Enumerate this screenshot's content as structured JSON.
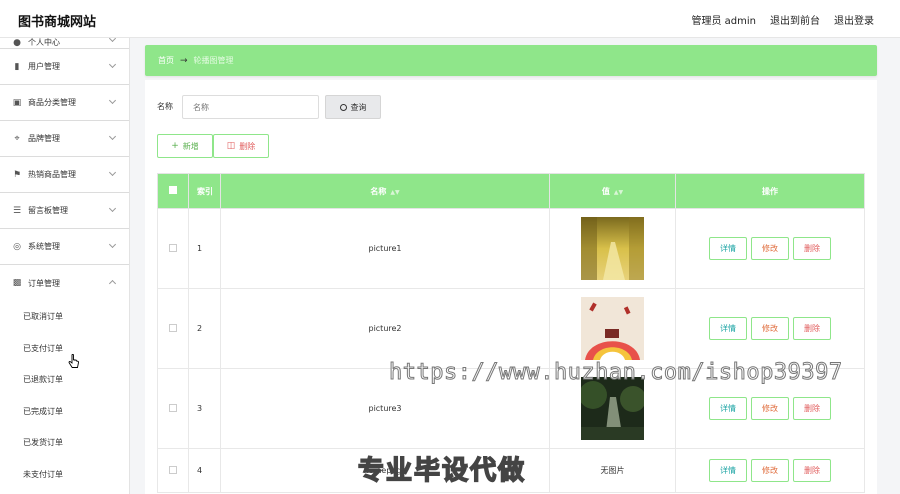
{
  "header": {
    "site_title": "图书商城网站",
    "admin_label": "管理员 admin",
    "exit_front": "退出到前台",
    "logout": "退出登录"
  },
  "sidebar": {
    "items": [
      {
        "label": "个人中心",
        "icon": "person-icon"
      },
      {
        "label": "用户管理",
        "icon": "bar-chart-icon"
      },
      {
        "label": "商品分类管理",
        "icon": "inbox-icon"
      },
      {
        "label": "品牌管理",
        "icon": "crop-icon"
      },
      {
        "label": "热销商品管理",
        "icon": "flag-icon"
      },
      {
        "label": "留言板管理",
        "icon": "list-icon"
      },
      {
        "label": "系统管理",
        "icon": "circle-icon"
      },
      {
        "label": "订单管理",
        "icon": "clipboard-icon"
      }
    ],
    "sub_items": [
      "已取消订单",
      "已支付订单",
      "已退款订单",
      "已完成订单",
      "已发货订单",
      "未支付订单"
    ]
  },
  "breadcrumb": {
    "home": "首页",
    "arrow": "→",
    "current": "轮播图管理"
  },
  "search": {
    "label": "名称",
    "placeholder": "名称",
    "button": "查询"
  },
  "actions": {
    "add": "新增",
    "delete": "删除"
  },
  "table": {
    "headers": {
      "index": "索引",
      "name": "名称",
      "value": "值",
      "ops": "操作"
    },
    "rows": [
      {
        "index": "1",
        "name": "picture1",
        "value": "",
        "has_image": true
      },
      {
        "index": "2",
        "name": "picture2",
        "value": "",
        "has_image": true
      },
      {
        "index": "3",
        "name": "picture3",
        "value": "",
        "has_image": true
      },
      {
        "index": "4",
        "name": "homepage",
        "value": "无图片",
        "has_image": false
      }
    ],
    "op_labels": {
      "detail": "详情",
      "edit": "修改",
      "remove": "删除"
    }
  },
  "watermark": {
    "url": "https://www.huzhan.com/ishop39397",
    "text": "专业毕设代做"
  },
  "colors": {
    "accent": "#8fe68a",
    "danger": "#e05b5b",
    "detail": "#1aa3a3",
    "edit": "#e06c3c"
  }
}
